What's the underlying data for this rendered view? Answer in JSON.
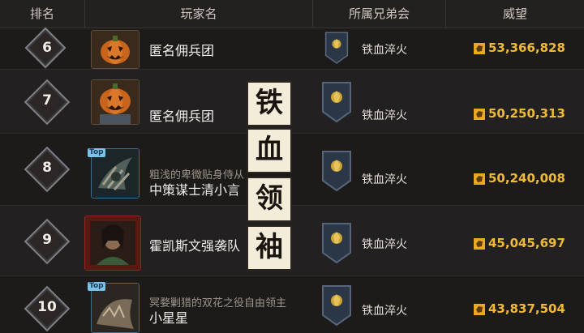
{
  "table": {
    "headers": {
      "rank": "排名",
      "player": "玩家名",
      "guild": "所属兄弟会",
      "reputation": "威望"
    },
    "rows": [
      {
        "rank": "6",
        "name": "匿名佣兵团",
        "subtitle": "",
        "guild": "铁血淬火",
        "reputation": "53,366,828",
        "avatar": "pumpkin-avatar-icon",
        "badge": ""
      },
      {
        "rank": "7",
        "name": "匿名佣兵团",
        "subtitle": "",
        "guild": "铁血淬火",
        "reputation": "50,250,313",
        "avatar": "pumpkin-avatar-icon",
        "badge": ""
      },
      {
        "rank": "8",
        "name": "中策谋士清小言",
        "subtitle": "粗浅的卑微贴身侍从",
        "guild": "铁血淬火",
        "reputation": "50,240,008",
        "avatar": "claw-avatar-icon",
        "badge": "Top"
      },
      {
        "rank": "9",
        "name": "霍凯斯文强袭队",
        "subtitle": "",
        "guild": "铁血淬火",
        "reputation": "45,045,697",
        "avatar": "warrior-avatar-icon",
        "badge": ""
      },
      {
        "rank": "10",
        "name": "小星星",
        "subtitle": "冥婺剿猎的双花之役自由领主",
        "guild": "铁血淬火",
        "reputation": "43,837,504",
        "avatar": "beast-avatar-icon",
        "badge": "Top"
      }
    ]
  },
  "overlay": {
    "chars": [
      "铁",
      "血",
      "领",
      "袖"
    ]
  },
  "colors": {
    "reputation": "#f0b935",
    "background": "#1d1b1a"
  }
}
